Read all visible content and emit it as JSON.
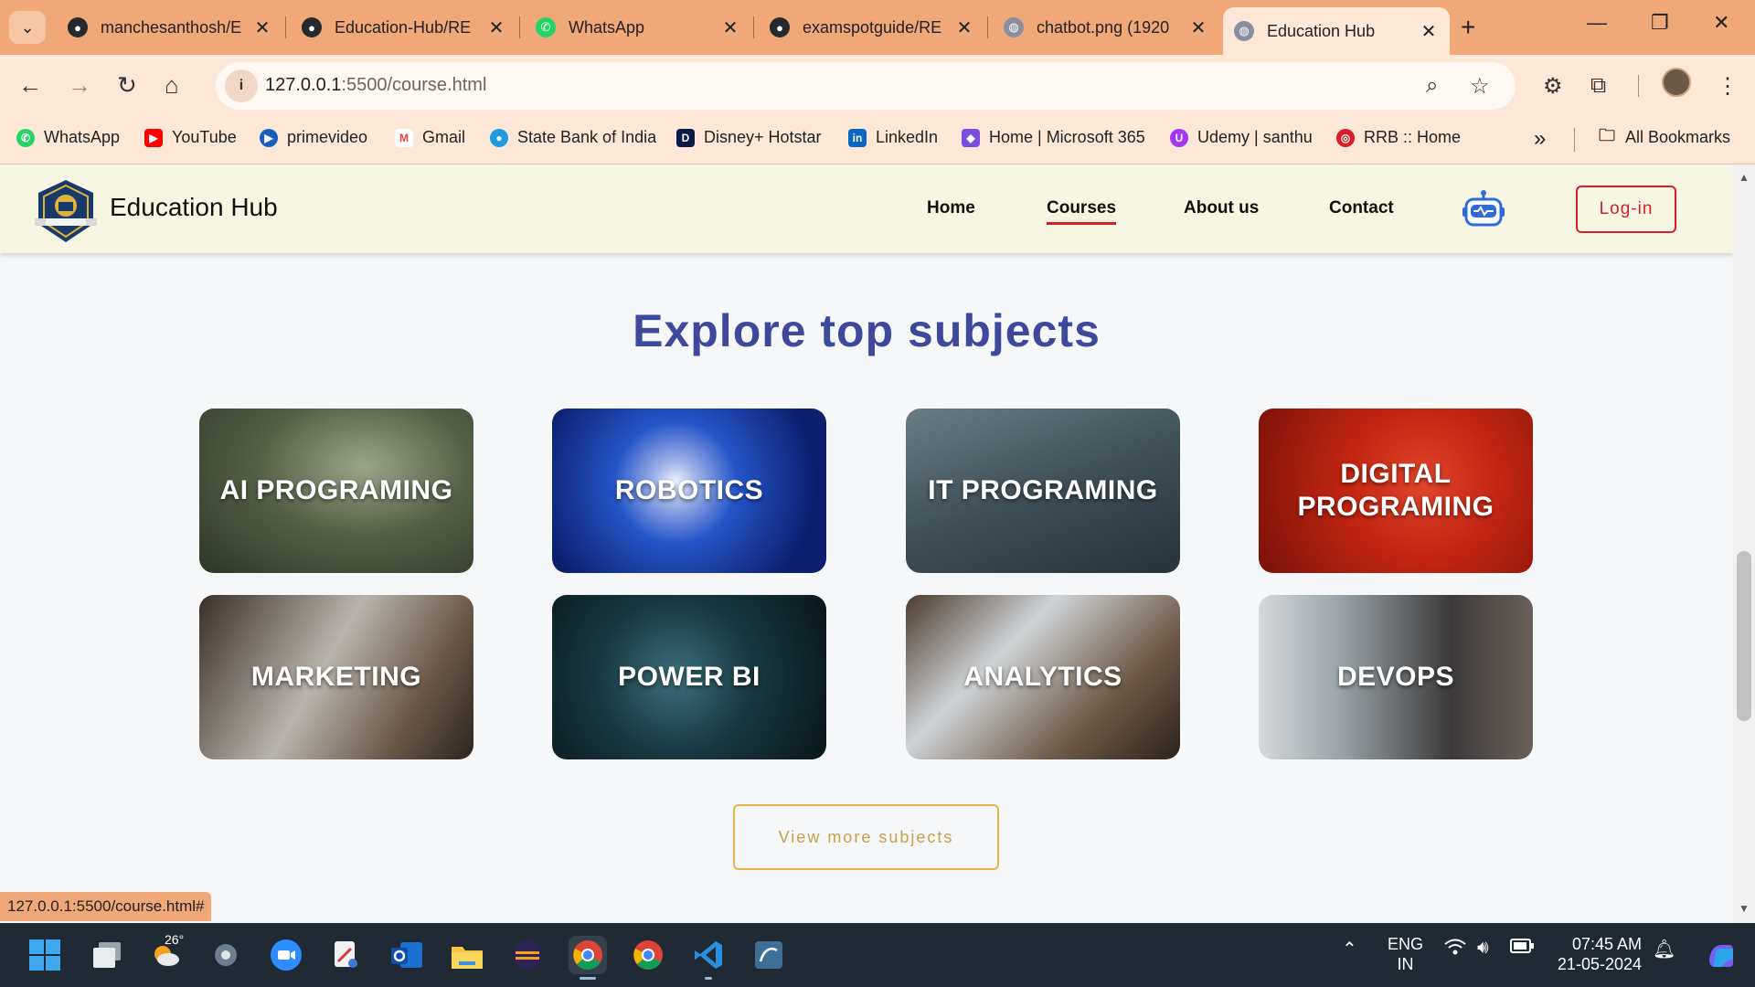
{
  "browser": {
    "tabs": [
      {
        "title": "manchesanthosh/E",
        "icon": "github-icon",
        "color": "#24292e"
      },
      {
        "title": "Education-Hub/RE",
        "icon": "github-icon",
        "color": "#24292e"
      },
      {
        "title": "WhatsApp",
        "icon": "whatsapp-icon",
        "color": "#25d366"
      },
      {
        "title": "examspotguide/RE",
        "icon": "github-icon",
        "color": "#24292e"
      },
      {
        "title": "chatbot.png (1920",
        "icon": "globe-icon",
        "color": "#8a8fa0"
      },
      {
        "title": "Education Hub",
        "icon": "globe-icon",
        "color": "#8a8fa0",
        "active": true
      }
    ],
    "url_host": "127.0.0.1",
    "url_rest": ":5500/course.html",
    "bookmarks": [
      {
        "label": "WhatsApp",
        "color": "#25d366",
        "glyph": "✆"
      },
      {
        "label": "YouTube",
        "color": "#ff0000",
        "glyph": "▶"
      },
      {
        "label": "primevideo",
        "color": "#1a5ec2",
        "glyph": "▶"
      },
      {
        "label": "Gmail",
        "color": "#ea4335",
        "glyph": "M"
      },
      {
        "label": "State Bank of India",
        "color": "#1d9be2",
        "glyph": "●"
      },
      {
        "label": "Disney+ Hotstar",
        "color": "#0c1a4a",
        "glyph": "D"
      },
      {
        "label": "LinkedIn",
        "color": "#0a66c2",
        "glyph": "in"
      },
      {
        "label": "Home | Microsoft 365",
        "color": "#7b4de0",
        "glyph": "◆"
      },
      {
        "label": "Udemy | santhu",
        "color": "#a435f0",
        "glyph": "U"
      },
      {
        "label": "RRB :: Home",
        "color": "#d81e28",
        "glyph": "◎"
      }
    ],
    "all_bookmarks": "All Bookmarks",
    "status_url": "127.0.0.1:5500/course.html#"
  },
  "site": {
    "brand": "Education Hub",
    "nav": [
      "Home",
      "Courses",
      "About us",
      "Contact"
    ],
    "active_nav": "Courses",
    "login": "Log-in",
    "section_title": "Explore top subjects",
    "subjects": [
      {
        "line1": "AI PROGRAMING",
        "line2": ""
      },
      {
        "line1": "ROBOTICS",
        "line2": ""
      },
      {
        "line1": "IT PROGRAMING",
        "line2": ""
      },
      {
        "line1": "DIGITAL",
        "line2": "PROGRAMING"
      },
      {
        "line1": "MARKETING",
        "line2": ""
      },
      {
        "line1": "POWER BI",
        "line2": ""
      },
      {
        "line1": "ANALYTICS",
        "line2": ""
      },
      {
        "line1": "DEVOPS",
        "line2": ""
      }
    ],
    "view_more": "View more subjects"
  },
  "taskbar": {
    "temperature": "26°",
    "lang_line1": "ENG",
    "lang_line2": "IN",
    "time": "07:45 AM",
    "date": "21-05-2024"
  },
  "colors": {
    "accent_red": "#d71e28",
    "title_blue": "#3d4a9c",
    "button_gold": "#e6b44a",
    "tab_orange": "#f0a878"
  }
}
